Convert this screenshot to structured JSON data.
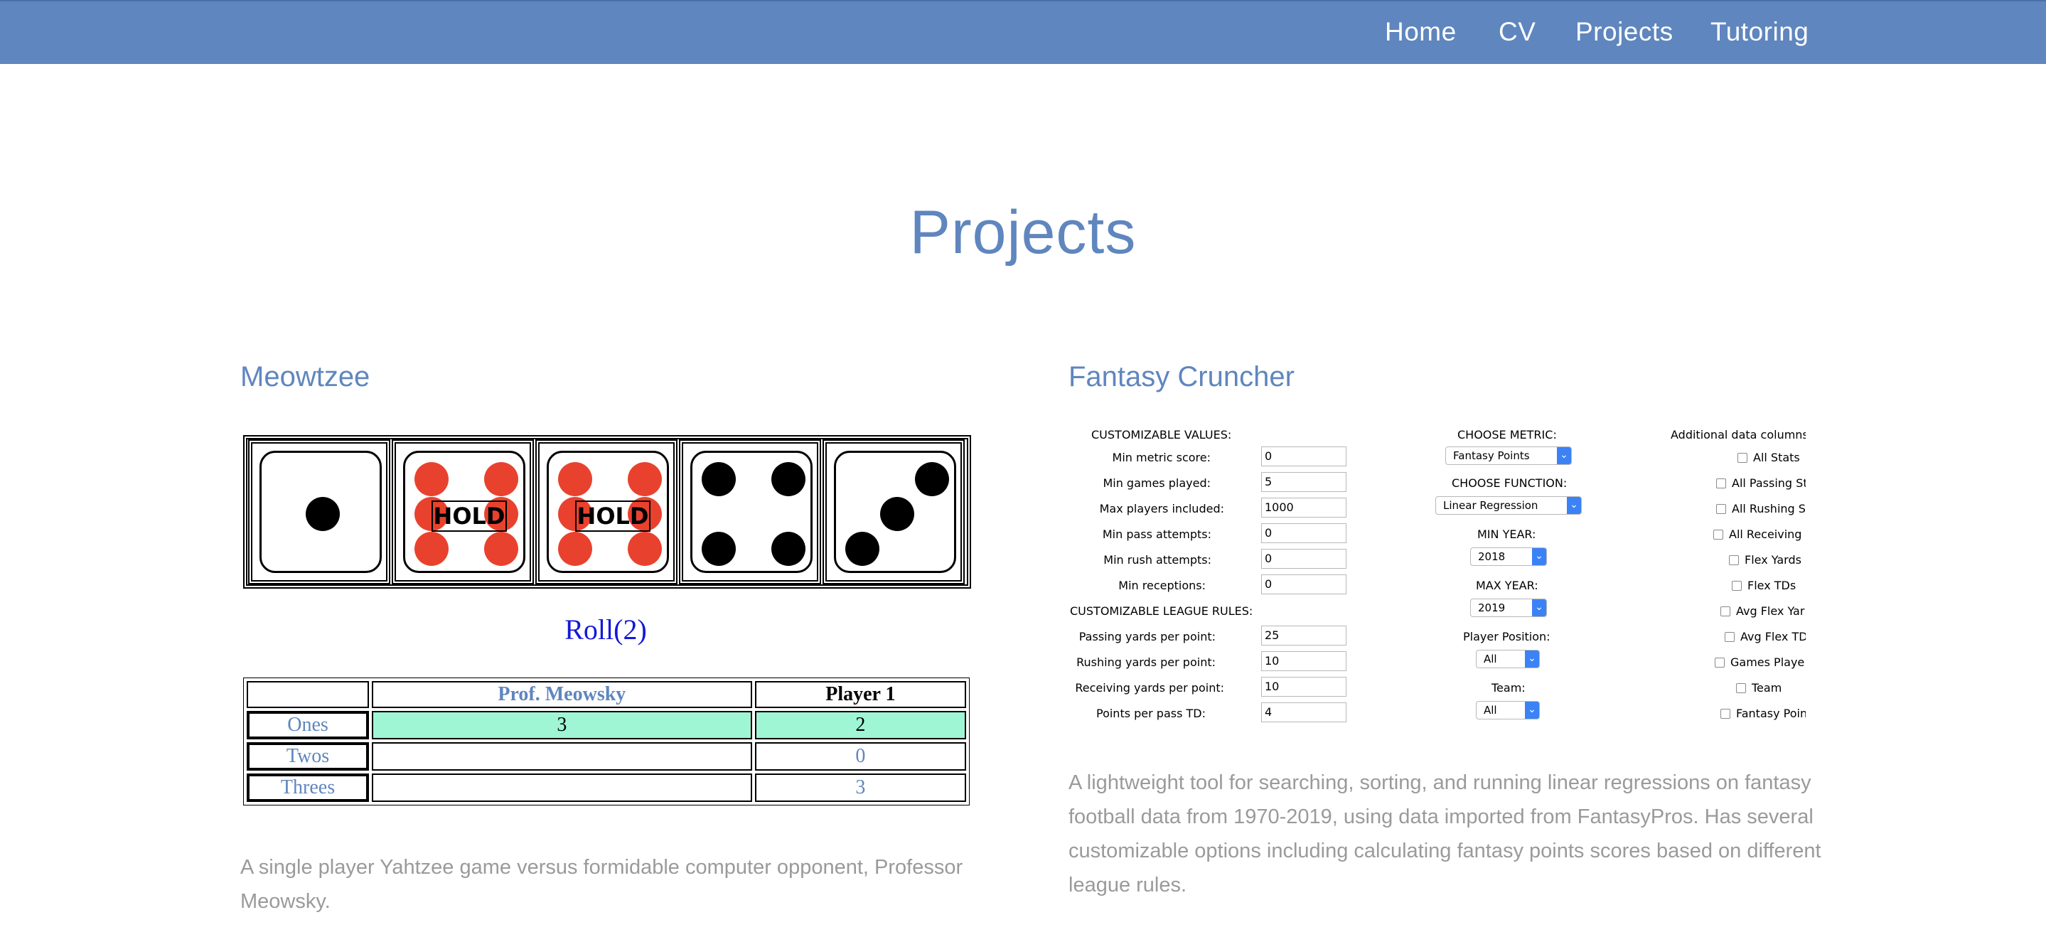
{
  "nav": {
    "home": "Home",
    "cv": "CV",
    "projects": "Projects",
    "tutoring": "Tutoring"
  },
  "page_title": "Projects",
  "colors": {
    "navbar": "#5f86be",
    "accent": "#5f86be",
    "pip_red": "#e8422f",
    "score_fill": "#9ff6d4",
    "roll_link": "#1418d8"
  },
  "meowtzee": {
    "title": "Meowtzee",
    "dice": [
      {
        "value": 1,
        "held": false
      },
      {
        "value": 6,
        "held": true
      },
      {
        "value": 6,
        "held": true
      },
      {
        "value": 4,
        "held": false
      },
      {
        "value": 3,
        "held": false
      }
    ],
    "hold_label": "HOLD",
    "roll_label": "Roll(2)",
    "table": {
      "headers": [
        "",
        "Prof. Meowsky",
        "Player 1"
      ],
      "rows": [
        {
          "label": "Ones",
          "prof": "3",
          "player": "2"
        },
        {
          "label": "Twos",
          "prof": "",
          "player": "0"
        },
        {
          "label": "Threes",
          "prof": "",
          "player": "3"
        }
      ]
    },
    "description": "A single player Yahtzee game versus formidable computer opponent, Professor Meowsky."
  },
  "fantasy": {
    "title": "Fantasy Cruncher",
    "customizable_values_label": "CUSTOMIZABLE VALUES:",
    "fields": [
      {
        "label": "Min metric score:",
        "value": "0"
      },
      {
        "label": "Min games played:",
        "value": "5"
      },
      {
        "label": "Max players included:",
        "value": "1000"
      },
      {
        "label": "Min pass attempts:",
        "value": "0"
      },
      {
        "label": "Min rush attempts:",
        "value": "0"
      },
      {
        "label": "Min receptions:",
        "value": "0"
      }
    ],
    "league_rules_label": "CUSTOMIZABLE LEAGUE RULES:",
    "league_fields": [
      {
        "label": "Passing yards per point:",
        "value": "25"
      },
      {
        "label": "Rushing yards per point:",
        "value": "10"
      },
      {
        "label": "Receiving yards per point:",
        "value": "10"
      },
      {
        "label": "Points per pass TD:",
        "value": "4"
      }
    ],
    "choose_metric_label": "CHOOSE METRIC:",
    "metric_value": "Fantasy Points",
    "choose_function_label": "CHOOSE FUNCTION:",
    "function_value": "Linear Regression",
    "min_year_label": "MIN YEAR:",
    "min_year_value": "2018",
    "max_year_label": "MAX YEAR:",
    "max_year_value": "2019",
    "player_position_label": "Player Position:",
    "player_position_value": "All",
    "team_label": "Team:",
    "team_value": "All",
    "additional_label": "Additional data columns",
    "checkboxes": [
      "All Stats",
      "All Passing St",
      "All Rushing S",
      "All Receiving S",
      "Flex Yards",
      "Flex TDs",
      "Avg Flex Yar",
      "Avg Flex TD",
      "Games Playe",
      "Team",
      "Fantasy Poin"
    ],
    "description": "A lightweight tool for searching, sorting, and running linear regressions on fantasy football data from 1970-2019, using data imported from FantasyPros. Has several customizable options including calculating fantasy points scores based on different league rules."
  }
}
